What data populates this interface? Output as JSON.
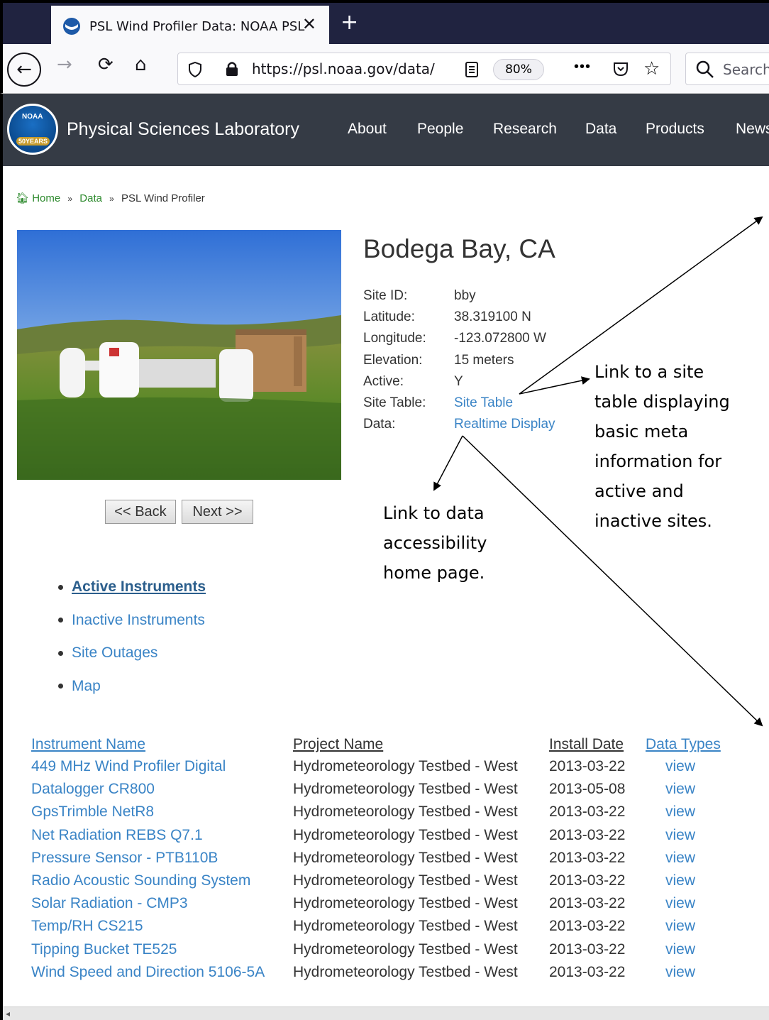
{
  "browser": {
    "tab_title": "PSL Wind Profiler Data: NOAA PSL",
    "new_tab": "+",
    "close": "✕",
    "url": "https://psl.noaa.gov/data/",
    "zoom": "80%",
    "search_placeholder": "Search",
    "more": "•••"
  },
  "header": {
    "logo_text": "NOAA",
    "logo_years": "50YEARS",
    "site_name": "Physical Sciences Laboratory",
    "nav": [
      "About",
      "People",
      "Research",
      "Data",
      "Products",
      "News"
    ]
  },
  "breadcrumb": {
    "home": "Home",
    "data": "Data",
    "current": "PSL Wind Profiler",
    "sep": "»"
  },
  "site": {
    "title": "Bodega Bay, CA",
    "fields": [
      {
        "key": "Site ID:",
        "value": "bby"
      },
      {
        "key": "Latitude:",
        "value": "38.319100 N"
      },
      {
        "key": "Longitude:",
        "value": "-123.072800 W"
      },
      {
        "key": "Elevation:",
        "value": "15 meters"
      },
      {
        "key": "Active:",
        "value": "Y"
      },
      {
        "key": "Site Table:",
        "value": "Site Table"
      },
      {
        "key": "Data:",
        "value": "Realtime Display"
      }
    ]
  },
  "buttons": {
    "back": "<< Back",
    "next": "Next >>"
  },
  "sidenav": [
    "Active Instruments",
    "Inactive Instruments",
    "Site Outages",
    "Map"
  ],
  "table": {
    "headers": [
      "Instrument Name",
      "Project Name",
      "Install Date",
      "Data Types"
    ],
    "rows": [
      [
        "449 MHz Wind Profiler Digital",
        "Hydrometeorology Testbed - West",
        "2013-03-22",
        "view"
      ],
      [
        "Datalogger CR800",
        "Hydrometeorology Testbed - West",
        "2013-05-08",
        "view"
      ],
      [
        "GpsTrimble NetR8",
        "Hydrometeorology Testbed - West",
        "2013-03-22",
        "view"
      ],
      [
        "Net Radiation REBS Q7.1",
        "Hydrometeorology Testbed - West",
        "2013-03-22",
        "view"
      ],
      [
        "Pressure Sensor - PTB110B",
        "Hydrometeorology Testbed - West",
        "2013-03-22",
        "view"
      ],
      [
        "Radio Acoustic Sounding System",
        "Hydrometeorology Testbed - West",
        "2013-03-22",
        "view"
      ],
      [
        "Solar Radiation - CMP3",
        "Hydrometeorology Testbed - West",
        "2013-03-22",
        "view"
      ],
      [
        "Temp/RH CS215",
        "Hydrometeorology Testbed - West",
        "2013-03-22",
        "view"
      ],
      [
        "Tipping Bucket TE525",
        "Hydrometeorology Testbed - West",
        "2013-03-22",
        "view"
      ],
      [
        "Wind Speed and Direction 5106-5A",
        "Hydrometeorology Testbed - West",
        "2013-03-22",
        "view"
      ]
    ]
  },
  "annotations": {
    "site_table": [
      "Link to a site",
      "table displaying",
      "basic meta",
      "information for",
      "active and",
      "inactive sites."
    ],
    "data_link": [
      "Link to data",
      "accessibility",
      "home page."
    ]
  }
}
